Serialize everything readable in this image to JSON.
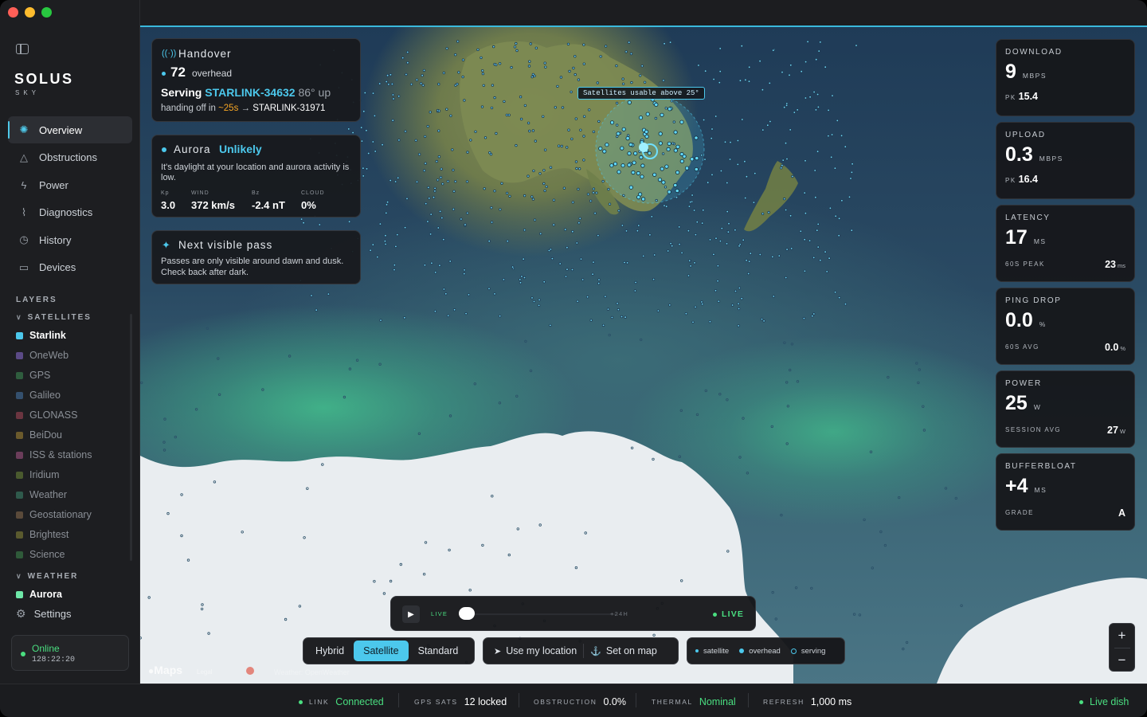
{
  "brand": {
    "name": "SOLUS",
    "sub": "SKY"
  },
  "nav": [
    {
      "label": "Overview",
      "icon": "orbit-icon",
      "active": true
    },
    {
      "label": "Obstructions",
      "icon": "triangle-icon"
    },
    {
      "label": "Power",
      "icon": "bolt-icon"
    },
    {
      "label": "Diagnostics",
      "icon": "pulse-icon"
    },
    {
      "label": "History",
      "icon": "clock-icon"
    },
    {
      "label": "Devices",
      "icon": "router-icon"
    }
  ],
  "layers": {
    "title": "LAYERS",
    "satellites_title": "SATELLITES",
    "satellites": [
      {
        "label": "Starlink",
        "color": "#4cc8ec",
        "on": true
      },
      {
        "label": "OneWeb",
        "color": "#5b4a86"
      },
      {
        "label": "GPS",
        "color": "#2f5d3e"
      },
      {
        "label": "Galileo",
        "color": "#34506e"
      },
      {
        "label": "GLONASS",
        "color": "#6b3540"
      },
      {
        "label": "BeiDou",
        "color": "#6b5a2c"
      },
      {
        "label": "ISS & stations",
        "color": "#6b3d5a"
      },
      {
        "label": "Iridium",
        "color": "#4a5a2e"
      },
      {
        "label": "Weather",
        "color": "#2f5a4c"
      },
      {
        "label": "Geostationary",
        "color": "#5a4a3a"
      },
      {
        "label": "Brightest",
        "color": "#5a5a2e"
      },
      {
        "label": "Science",
        "color": "#2f5a3a"
      }
    ],
    "weather_title": "WEATHER",
    "weather": [
      {
        "label": "Aurora",
        "color": "#6ee7a8",
        "on": true
      }
    ]
  },
  "settings_label": "Settings",
  "status": {
    "state": "Online",
    "uptime": "128:22:20"
  },
  "handover": {
    "title": "Handover",
    "overhead_count": "72",
    "overhead_label": "overhead",
    "serving_prefix": "Serving",
    "serving_sat": "STARLINK-34632",
    "serving_elev": "86° up",
    "handoff_prefix": "handing off in",
    "handoff_time": "~25s",
    "handoff_arrow": "→",
    "handoff_sat": "STARLINK-31971"
  },
  "aurora": {
    "title": "Aurora",
    "status": "Unlikely",
    "desc": "It's daylight at your location and aurora activity is low.",
    "stats": [
      {
        "k": "Kp",
        "v": "3.0"
      },
      {
        "k": "WIND",
        "v": "372 km/s"
      },
      {
        "k": "Bz",
        "v": "-2.4 nT"
      },
      {
        "k": "CLOUD",
        "v": "0%"
      }
    ]
  },
  "next_pass": {
    "title": "Next visible pass",
    "desc": "Passes are only visible around dawn and dusk. Check back after dark."
  },
  "map_tooltip": "Satellites usable above 25°",
  "metrics": [
    {
      "label": "DOWNLOAD",
      "value": "9",
      "unit": "MBPS",
      "sub_label": "PK",
      "sub_value": "15.4",
      "right": "",
      "right_unit": ""
    },
    {
      "label": "UPLOAD",
      "value": "0.3",
      "unit": "MBPS",
      "sub_label": "PK",
      "sub_value": "16.4",
      "right": "",
      "right_unit": ""
    },
    {
      "label": "LATENCY",
      "value": "17",
      "unit": "MS",
      "sub_label": "60S PEAK",
      "sub_value": "",
      "right": "23",
      "right_unit": "ms"
    },
    {
      "label": "PING DROP",
      "value": "0.0",
      "unit": "%",
      "sub_label": "60S AVG",
      "sub_value": "",
      "right": "0.0",
      "right_unit": "%"
    },
    {
      "label": "POWER",
      "value": "25",
      "unit": "W",
      "sub_label": "SESSION AVG",
      "sub_value": "",
      "right": "27",
      "right_unit": "W"
    },
    {
      "label": "BUFFERBLOAT",
      "value": "+4",
      "unit": "MS",
      "sub_label": "GRADE",
      "sub_value": "",
      "right": "A",
      "right_unit": ""
    }
  ],
  "timeline": {
    "start": "LIVE",
    "end": "+24H",
    "live": "LIVE"
  },
  "map_type": {
    "options": [
      "Hybrid",
      "Satellite",
      "Standard"
    ],
    "selected": "Satellite"
  },
  "location": {
    "use": "Use my location",
    "set": "Set on map"
  },
  "legend": {
    "satellite": "satellite",
    "overhead": "overhead",
    "serving": "serving"
  },
  "attribution": {
    "maps": "Maps",
    "legal": "Legal",
    "weather": "Weather: OpenWeather"
  },
  "zoom": {
    "in": "+",
    "out": "−"
  },
  "bottombar": {
    "link_k": "LINK",
    "link_v": "Connected",
    "gps_k": "GPS SATS",
    "gps_v": "12 locked",
    "obs_k": "OBSTRUCTION",
    "obs_v": "0.0%",
    "thermal_k": "THERMAL",
    "thermal_v": "Nominal",
    "refresh_k": "REFRESH",
    "refresh_v": "1,000 ms",
    "dish": "Live dish"
  },
  "colors": {
    "accent": "#4cc8ec",
    "online": "#4ade80",
    "warn": "#f5a524"
  }
}
